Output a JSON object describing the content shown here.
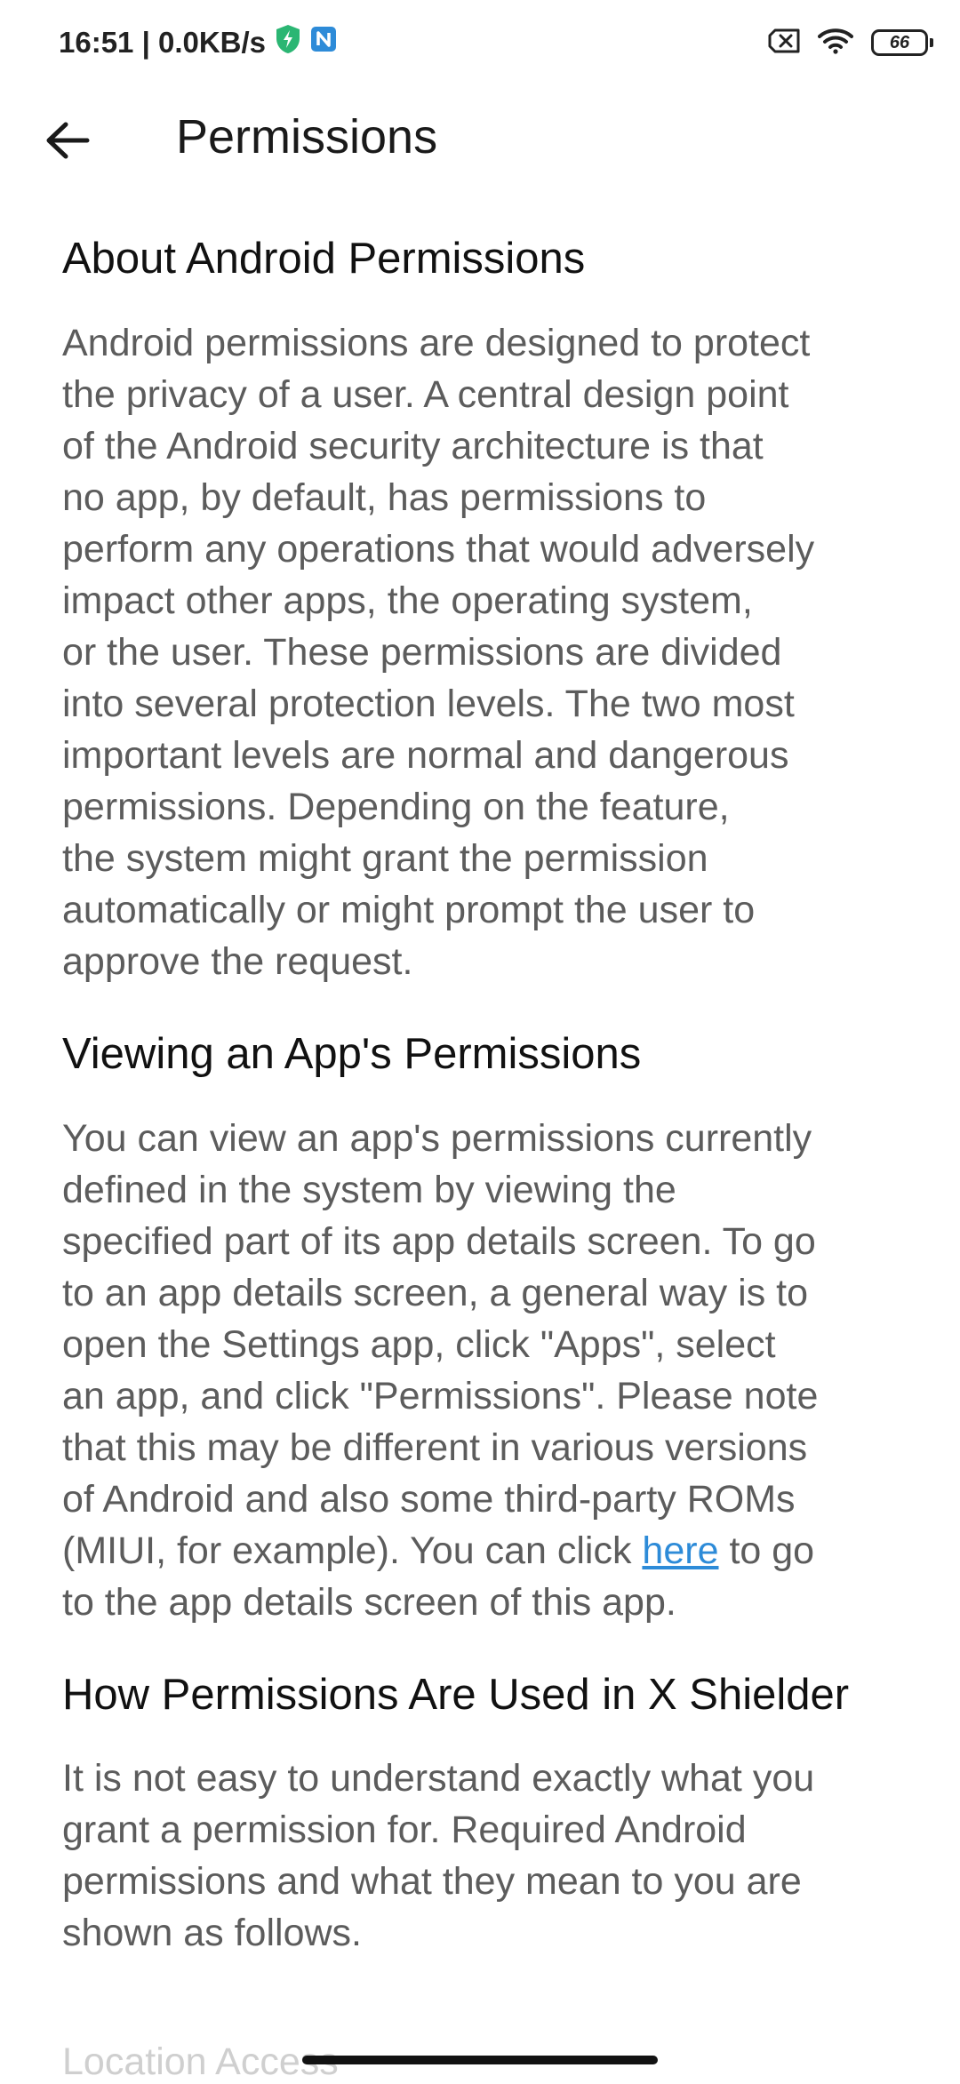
{
  "status_bar": {
    "time_speed": "16:51 | 0.0KB/s",
    "battery_level": "66",
    "shield_color": "#2bb673",
    "notif_color": "#2d8bd8"
  },
  "app_bar": {
    "back_icon": "arrow-left-icon",
    "title": "Permissions"
  },
  "sections": {
    "about": {
      "title": "About Android Permissions",
      "body": "Android permissions are designed to protect\nthe privacy of a user. A central design point\nof the Android security architecture is that\nno app, by default, has permissions to\nperform any operations that would adversely\nimpact other apps, the operating system,\nor the user. These permissions are divided\ninto several protection levels. The two most\nimportant levels are normal and dangerous\npermissions. Depending on the feature,\nthe system might grant the permission\nautomatically or might prompt the user to\napprove the request."
    },
    "viewing": {
      "title": "Viewing an App's Permissions",
      "body_before_link": "You can view an app's permissions currently\ndefined in the system by viewing the\nspecified part of its app details screen. To go\nto an app details screen, a general way is to\nopen the Settings app, click \"Apps\", select\nan app, and click \"Permissions\". Please note\nthat this may be different in various versions\nof Android and also some third-party ROMs\n(MIUI, for example). You can click ",
      "link_text": "here",
      "body_after_link": " to go\nto the app details screen of this app."
    },
    "usage": {
      "title": "How Permissions Are Used in X Shielder",
      "body": "It is not easy to understand exactly what you\ngrant a permission for. Required Android\npermissions and what they mean to you are\nshown as follows."
    }
  },
  "next_item": "Location Access"
}
